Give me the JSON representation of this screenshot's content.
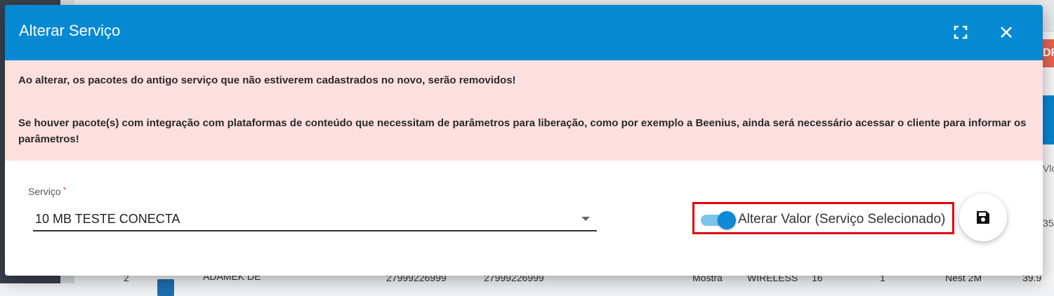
{
  "background": {
    "pdf_button_fragment": "DF",
    "column_header_fragment": "Vlo",
    "cell_fragment": "35.",
    "row": {
      "index": "2",
      "name": "ADAMEK DE",
      "phone1": "27999226999",
      "phone2": "27999226999",
      "col_status": "Mostra",
      "col_type": "WIRELESS",
      "col_num": "16",
      "col_qty": "1",
      "col_plan": "Nest 2M",
      "col_value": "39.9"
    }
  },
  "modal": {
    "title": "Alterar Serviço",
    "fullscreen_icon": "fullscreen-icon",
    "close_icon": "close-icon",
    "alert": {
      "line1": "Ao alterar, os pacotes do antigo serviço que não estiverem cadastrados no novo, serão removidos!",
      "line2": "Se houver pacote(s) com integração com plataformas de conteúdo que necessitam de parâmetros para liberação, como por exemplo a Beenius, ainda será necessário acessar o cliente para informar os parâmetros!"
    },
    "service_field": {
      "label": "Serviço",
      "required_mark": "*",
      "value": "10 MB TESTE CONECTA"
    },
    "toggle": {
      "label": "Alterar Valor (Serviço Selecionado)",
      "checked": true
    },
    "save_icon": "save-icon"
  },
  "colors": {
    "header": "#0689d3",
    "alert_bg": "#fddfe0",
    "toggle_knob": "#0b8ad6",
    "highlight": "#e3000f"
  }
}
